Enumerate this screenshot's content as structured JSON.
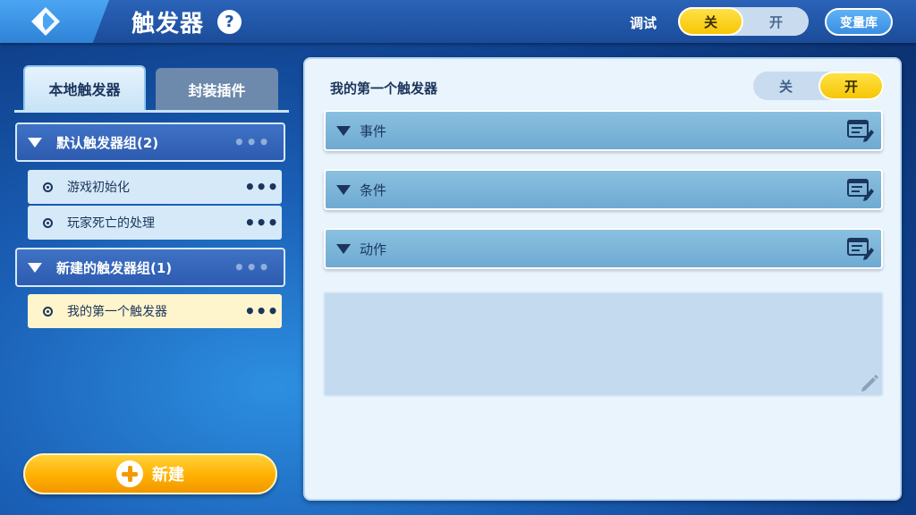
{
  "header": {
    "title": "触发器",
    "help_label": "?",
    "debug_label": "调试",
    "debug_toggle": {
      "off_label": "关",
      "on_label": "开",
      "state": "off"
    },
    "variable_library_label": "变量库"
  },
  "sidebar": {
    "tabs": [
      {
        "label": "本地触发器",
        "active": true
      },
      {
        "label": "封装插件",
        "active": false
      }
    ],
    "groups": [
      {
        "label": "默认触发器组(2)",
        "more": "•••",
        "items": [
          {
            "label": "游戏初始化",
            "more": "•••"
          },
          {
            "label": "玩家死亡的处理",
            "more": "•••"
          }
        ]
      },
      {
        "label": "新建的触发器组(1)",
        "more": "•••",
        "items": [
          {
            "label": "我的第一个触发器",
            "more": "•••",
            "active": true
          }
        ]
      }
    ],
    "new_button_label": "新建"
  },
  "detail": {
    "trigger_name": "我的第一个触发器",
    "enable_toggle": {
      "off_label": "关",
      "on_label": "开",
      "state": "on"
    },
    "sections": [
      {
        "label": "事件"
      },
      {
        "label": "条件"
      },
      {
        "label": "动作"
      }
    ],
    "note_value": ""
  },
  "colors": {
    "accent_yellow": "#f6c400",
    "header_blue": "#1b4c9a",
    "section_blue": "#6faad2"
  }
}
